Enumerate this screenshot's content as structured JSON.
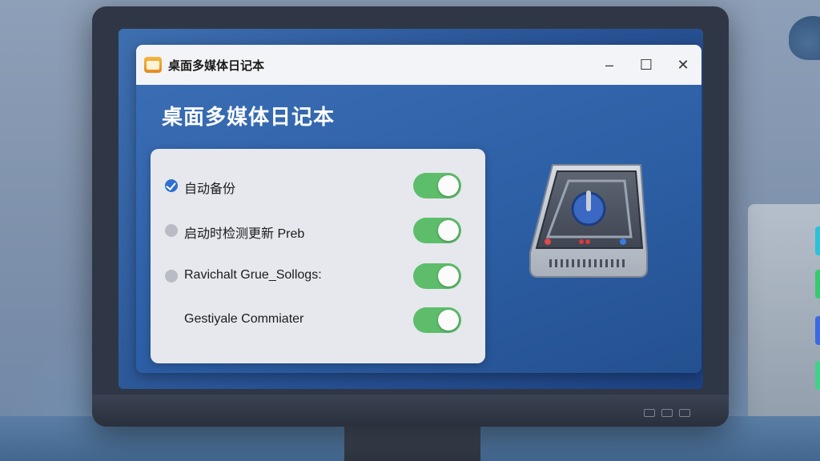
{
  "window": {
    "title": "桌面多媒体日记本",
    "controls": {
      "minimize": "–",
      "maximize": "☐",
      "close": "✕"
    }
  },
  "main": {
    "heading": "桌面多媒体日记本",
    "settings": [
      {
        "label": "自动备份",
        "checked": true,
        "toggle_on": true
      },
      {
        "label": "启动时检测更新 Preb",
        "checked": false,
        "toggle_on": true
      },
      {
        "label": "Ravichalt Grue_Sollogs:",
        "checked": false,
        "toggle_on": true
      },
      {
        "label": "Gestiyale Commiater",
        "checked": false,
        "toggle_on": true
      }
    ]
  },
  "illustration": {
    "icon": "hard-drive-icon"
  },
  "colors": {
    "accent": "#2f6fd0",
    "toggle_on": "#5dbd6a",
    "window_bg": "#2c5ea4",
    "panel_bg": "#e6e8ee"
  }
}
